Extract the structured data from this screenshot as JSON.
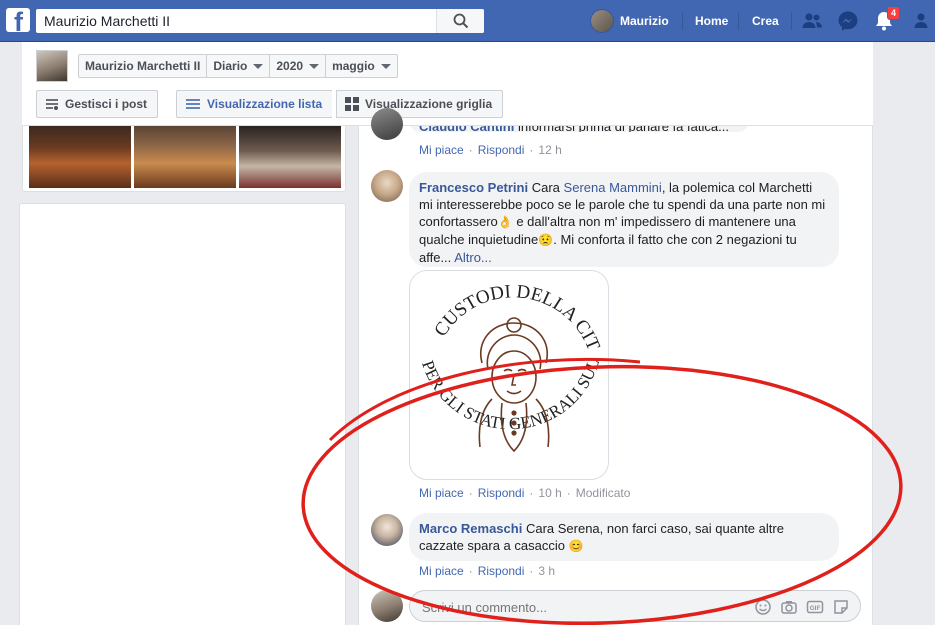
{
  "topbar": {
    "search_value": "Maurizio Marchetti II",
    "user_name": "Maurizio",
    "home_label": "Home",
    "create_label": "Crea",
    "notifications_count": "4",
    "icons": [
      "facebook-logo-icon",
      "search-icon",
      "friends-icon",
      "messenger-icon",
      "notifications-icon",
      "help-icon"
    ]
  },
  "header": {
    "page_name": "Maurizio Marchetti II",
    "section": "Diario",
    "year": "2020",
    "month": "maggio",
    "manage_posts": "Gestisci i post",
    "list_view": "Visualizzazione lista",
    "grid_view": "Visualizzazione griglia"
  },
  "comments": [
    {
      "author": "Claudio Cantini",
      "text": "informarsi prima di parlare fa fatica...",
      "like": "Mi piace",
      "reply": "Rispondi",
      "time": "12 h"
    },
    {
      "author": "Francesco Petrini",
      "text_intro": "Cara",
      "mention": "Serena Mammini",
      "text_line1": ", la polemica col Marchetti",
      "text_line2": "mi interesserebbe poco se le parole che tu spendi da una parte non mi",
      "text_line3a": "confortassero",
      "text_line3b": " e dall'altra non m' impedissero di mantenere una",
      "text_line4a": "qualche inquietudine",
      "text_line4b": ". Mi conforta il fatto che con 2 negazioni tu",
      "text_line5": "affe...",
      "more": "Altro...",
      "image_text_top": "CUSTODI DELLA CITTÀ",
      "image_text_bottom": "PER GLI STATI GENERALI SULLA CULTURA",
      "like": "Mi piace",
      "reply": "Rispondi",
      "time": "10 h",
      "edited": "Modificato"
    },
    {
      "author": "Marco Remaschi",
      "text_line1": "Cara Serena, non farci caso, sai quante altre",
      "text_line2": "cazzate spara a casaccio",
      "like": "Mi piace",
      "reply": "Rispondi",
      "time": "3 h"
    }
  ],
  "composer": {
    "placeholder": "Scrivi un commento..."
  },
  "colors": {
    "brand": "#4267b2",
    "link": "#385898",
    "annotation": "#e0201b"
  }
}
